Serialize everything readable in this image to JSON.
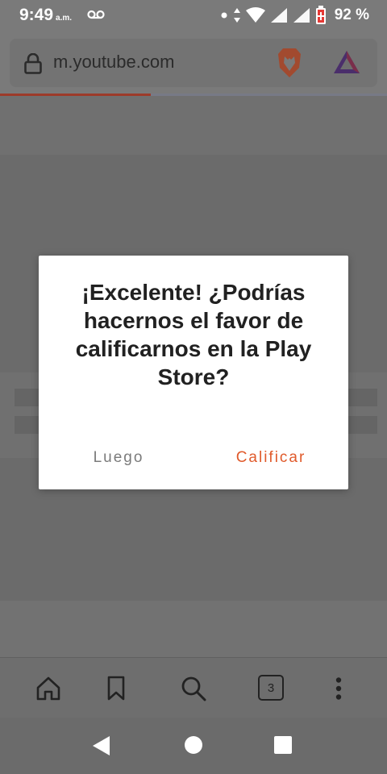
{
  "status_bar": {
    "time": "9:49",
    "ampm": "a.m.",
    "battery_percent": "92 %"
  },
  "browser": {
    "url": "m.youtube.com",
    "load_progress": 0.39,
    "tab_count": "3"
  },
  "dialog": {
    "message": "¡Excelente! ¿Podrías hacernos el favor de calificarnos en la Play Store?",
    "later_label": "Luego",
    "rate_label": "Calificar"
  },
  "colors": {
    "accent": "#e05a2b",
    "secondary_text": "#7b7b7b",
    "brave_orange": "#e9562c",
    "bat_purple": "#662d91"
  },
  "icons": {
    "voicemail": "voicemail-icon",
    "wifi": "wifi-icon",
    "signal": "signal-icon",
    "battery": "battery-icon",
    "lock": "lock-icon",
    "brave": "brave-lion-icon",
    "rewards": "bat-triangle-icon",
    "home": "home-icon",
    "bookmark": "bookmark-icon",
    "search": "search-icon",
    "menu": "more-vert-icon"
  }
}
